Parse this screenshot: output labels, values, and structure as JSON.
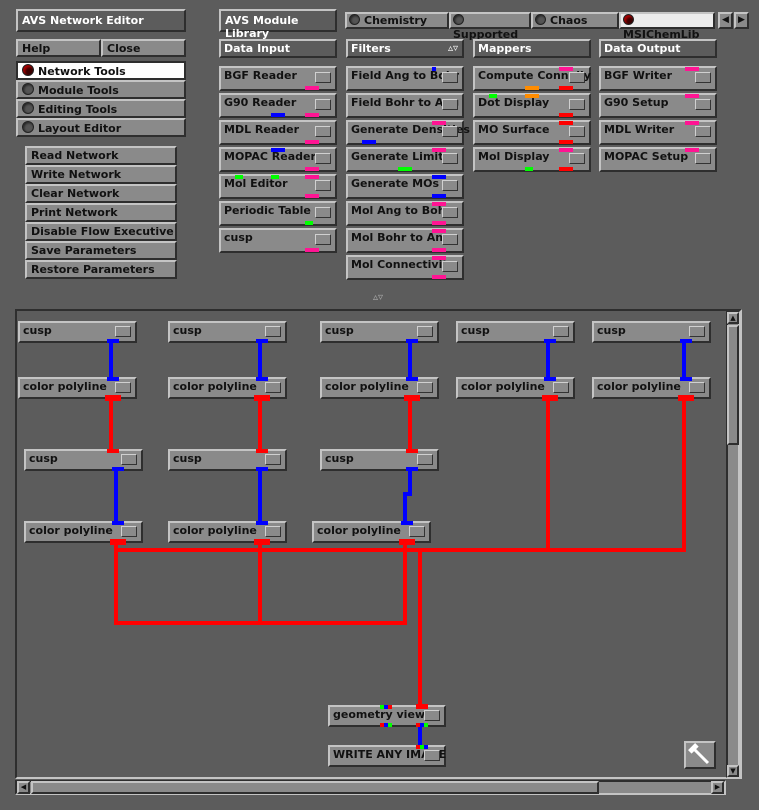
{
  "window": {
    "title": "AVS Network Editor"
  },
  "menu": {
    "help": "Help",
    "close": "Close"
  },
  "tool_tabs": [
    "Network Tools",
    "Module Tools",
    "Editing Tools",
    "Layout Editor"
  ],
  "actions": [
    "Read Network",
    "Write Network",
    "Clear Network",
    "Print Network",
    "Disable Flow Executive",
    "Save Parameters",
    "Restore Parameters"
  ],
  "library": {
    "title": "AVS Module Library",
    "tabs": [
      "Chemistry",
      "Supported",
      "Chaos",
      "MSIChemLib"
    ],
    "selected_tab": "MSIChemLib",
    "columns": [
      {
        "header": "Data Input",
        "modules": [
          "BGF Reader",
          "G90 Reader",
          "MDL Reader",
          "MOPAC Reader",
          "Mol Editor",
          "Periodic Table",
          "cusp"
        ]
      },
      {
        "header": "Filters",
        "modules": [
          "Field Ang to Bohr",
          "Field Bohr to Ang",
          "Generate Densities",
          "Generate Limits",
          "Generate MOs",
          "Mol Ang to Bohr",
          "Mol Bohr to Ang",
          "Mol Connectivity"
        ]
      },
      {
        "header": "Mappers",
        "modules": [
          "Compute Connolly",
          "Dot Display",
          "MO Surface",
          "Mol Display"
        ]
      },
      {
        "header": "Data Output",
        "modules": [
          "BGF Writer",
          "G90 Setup",
          "MDL Writer",
          "MOPAC Setup"
        ]
      }
    ]
  },
  "network": {
    "cusp": "cusp",
    "color_polyline": "color polyline",
    "geometry_viewer": "geometry viewer",
    "write_image": "WRITE ANY IMAGE"
  },
  "colors": {
    "wire_red": "#ff0000",
    "wire_blue": "#0000ff",
    "port_magenta": "#ff1493",
    "port_green": "#00ff00",
    "panel": "#8a8a8a",
    "background": "#5c5c5c"
  }
}
